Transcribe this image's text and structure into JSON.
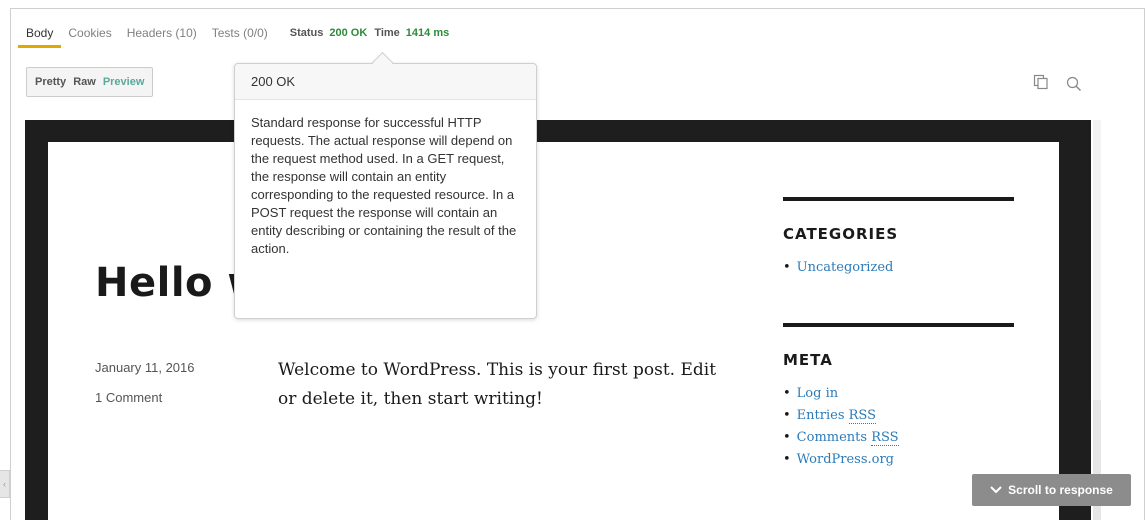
{
  "tabs": [
    {
      "label": "Body",
      "active": true
    },
    {
      "label": "Cookies",
      "active": false
    },
    {
      "label": "Headers (10)",
      "active": false
    },
    {
      "label": "Tests (0/0)",
      "active": false
    }
  ],
  "status": {
    "status_label": "Status",
    "status_value": "200 OK",
    "time_label": "Time",
    "time_value": "1414 ms"
  },
  "view_modes": {
    "pretty": "Pretty",
    "raw": "Raw",
    "preview": "Preview",
    "selected": "Preview"
  },
  "toolbar_icons": [
    "copy-icon",
    "search-icon"
  ],
  "tooltip": {
    "title": "200 OK",
    "body": "Standard response for successful HTTP requests. The actual response will depend on the request method used. In a GET request, the response will contain an entity corresponding to the requested resource. In a POST request the response will contain an entity describing or containing the result of the action."
  },
  "preview": {
    "post_title": "Hello world!",
    "date": "January 11, 2016",
    "comments": "1 Comment",
    "body": "Welcome to WordPress. This is your first post. Edit or delete it, then start writing!",
    "categories_heading": "CATEGORIES",
    "categories": [
      "Uncategorized"
    ],
    "meta_heading": "META",
    "meta": {
      "log_in": "Log in",
      "entries_prefix": "Entries",
      "comments_prefix": "Comments",
      "rss": "RSS",
      "wordpress_org": "WordPress.org"
    }
  },
  "scroll_button": {
    "label": "Scroll to response",
    "icon": "chevron-down-icon"
  },
  "colors": {
    "active_tab_underline": "#e0a800",
    "status_ok": "#2e8b3a",
    "preview_selected": "#5aa89a",
    "link": "#2b7bb9",
    "scroll_button_bg": "#8c8c8c"
  }
}
